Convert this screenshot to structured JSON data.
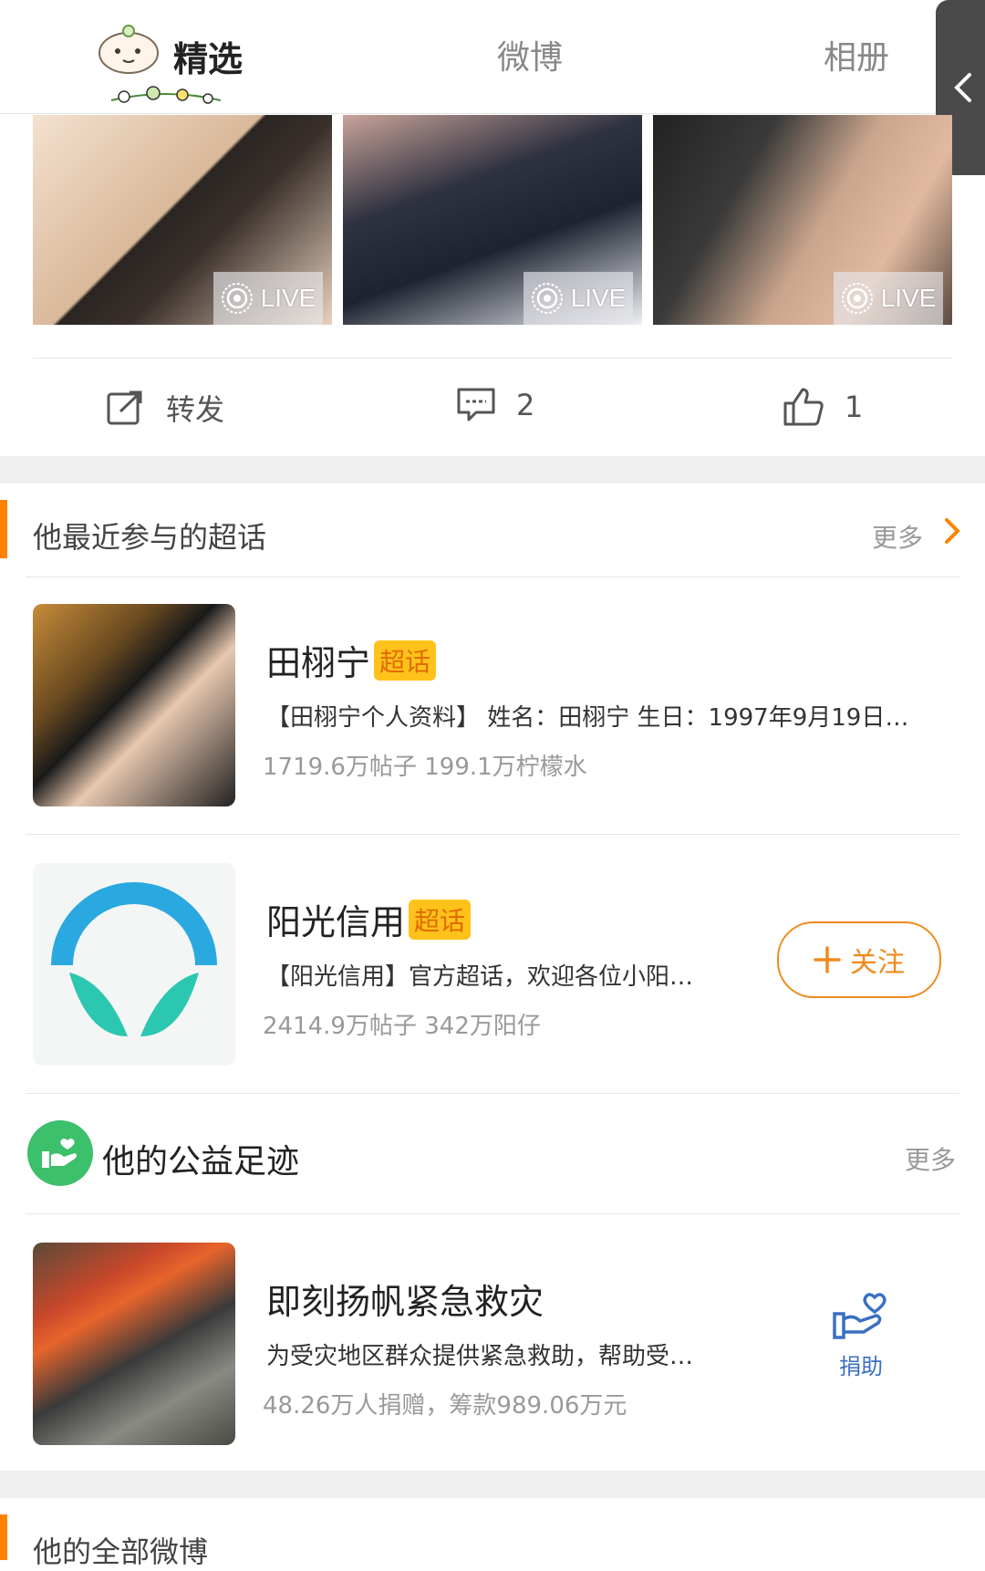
{
  "tabs": {
    "selected": "精选",
    "weibo": "微博",
    "album": "相册"
  },
  "photos": [
    {
      "badge": "LIVE"
    },
    {
      "badge": "LIVE"
    },
    {
      "badge": "LIVE"
    }
  ],
  "actions": {
    "repost": "转发",
    "comments": "2",
    "likes": "1"
  },
  "supertopics": {
    "title": "他最近参与的超话",
    "more": "更多",
    "items": [
      {
        "name": "田栩宁",
        "tag": "超话",
        "desc": "【田栩宁个人资料】 姓名：田栩宁 生日：1997年9月19日…",
        "meta": "1719.6万帖子 199.1万柠檬水"
      },
      {
        "name": "阳光信用",
        "tag": "超话",
        "desc": "【阳光信用】官方超话，欢迎各位小阳…",
        "meta": "2414.9万帖子 342万阳仔",
        "follow": "关注"
      }
    ]
  },
  "charity": {
    "title": "他的公益足迹",
    "more": "更多",
    "item": {
      "name": "即刻扬帆紧急救灾",
      "desc": "为受灾地区群众提供紧急救助，帮助受…",
      "meta": "48.26万人捐赠，筹款989.06万元",
      "donate": "捐助"
    }
  },
  "all_weibo": {
    "title": "他的全部微博"
  },
  "colors": {
    "accent_orange": "#ff8200",
    "tag_yellow": "#ffc21a",
    "charity_green": "#3cc06b",
    "donate_blue": "#3a6fc4"
  }
}
